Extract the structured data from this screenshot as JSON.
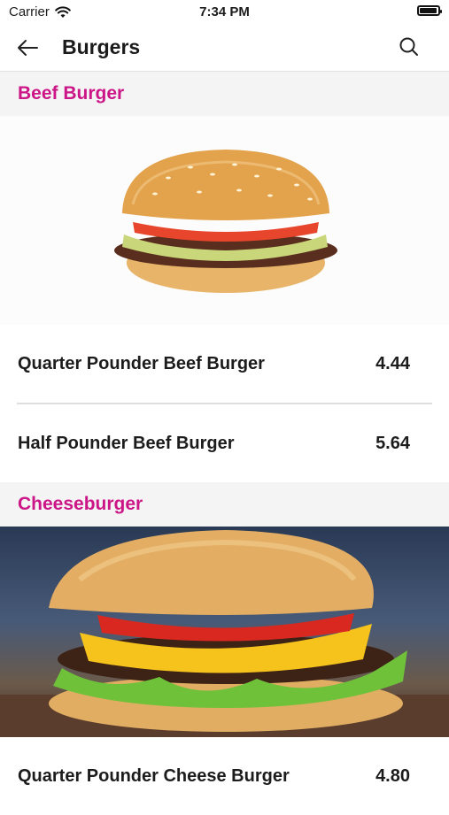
{
  "status": {
    "carrier": "Carrier",
    "time": "7:34 PM"
  },
  "nav": {
    "title": "Burgers"
  },
  "sections": [
    {
      "title": "Beef Burger",
      "items": [
        {
          "name": "Quarter Pounder Beef Burger",
          "price": "4.44"
        },
        {
          "name": "Half Pounder Beef Burger",
          "price": "5.64"
        }
      ]
    },
    {
      "title": "Cheeseburger",
      "items": [
        {
          "name": "Quarter Pounder Cheese Burger",
          "price": "4.80"
        }
      ]
    }
  ],
  "icons": [
    "wifi-icon",
    "battery-icon",
    "back-arrow-icon",
    "search-icon"
  ],
  "colors": {
    "section_title": "#cc1688",
    "section_bg": "#f4f4f4"
  }
}
